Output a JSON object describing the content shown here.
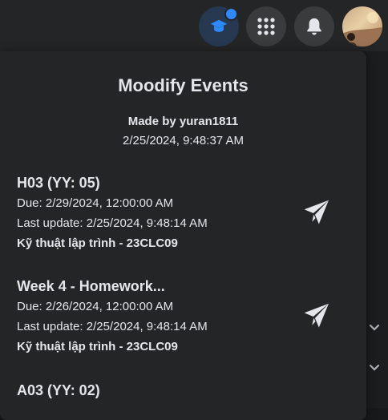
{
  "panel": {
    "title": "Moodify Events",
    "author": "Made by yuran1811",
    "updated_at": "2/25/2024, 9:48:37 AM"
  },
  "events": [
    {
      "name": "H03 (YY: 05)",
      "due": "Due: 2/29/2024, 12:00:00 AM",
      "last_update": "Last update: 2/25/2024, 9:48:14 AM",
      "course": "Kỹ thuật lập trình - 23CLC09"
    },
    {
      "name": "Week 4 - Homework...",
      "due": "Due: 2/26/2024, 12:00:00 AM",
      "last_update": "Last update: 2/25/2024, 9:48:14 AM",
      "course": "Kỹ thuật lập trình - 23CLC09"
    },
    {
      "name": "A03 (YY: 02)"
    }
  ],
  "icons": {
    "extension": "graduation-cap-icon",
    "menu": "grid-menu-icon",
    "notifications": "bell-icon",
    "send": "paper-plane-icon"
  },
  "colors": {
    "accent": "#2e89ff",
    "panel_bg": "#242526",
    "text": "#e4e6eb"
  }
}
